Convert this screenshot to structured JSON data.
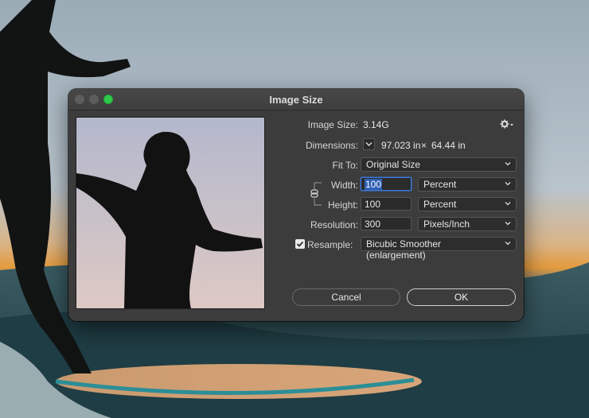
{
  "window": {
    "title": "Image Size"
  },
  "image_size": {
    "label": "Image Size:",
    "value": "3.14G"
  },
  "dimensions": {
    "label": "Dimensions:",
    "width": "97.023 in",
    "times": "×",
    "height": "64.44 in"
  },
  "fit_to": {
    "label": "Fit To:",
    "value": "Original Size"
  },
  "width": {
    "label": "Width:",
    "value": "100",
    "unit": "Percent"
  },
  "height": {
    "label": "Height:",
    "value": "100",
    "unit": "Percent"
  },
  "resolution": {
    "label": "Resolution:",
    "value": "300",
    "unit": "Pixels/Inch"
  },
  "resample": {
    "label": "Resample:",
    "checked": true,
    "value": "Bicubic Smoother (enlargement)"
  },
  "buttons": {
    "cancel": "Cancel",
    "ok": "OK"
  },
  "icons": {
    "settings": "gear-icon",
    "dimensions_toggle": "chevron-down-icon",
    "constrain": "link-icon"
  },
  "colors": {
    "zoom_button": "#2ec94a",
    "accent": "#2f5fb3"
  }
}
